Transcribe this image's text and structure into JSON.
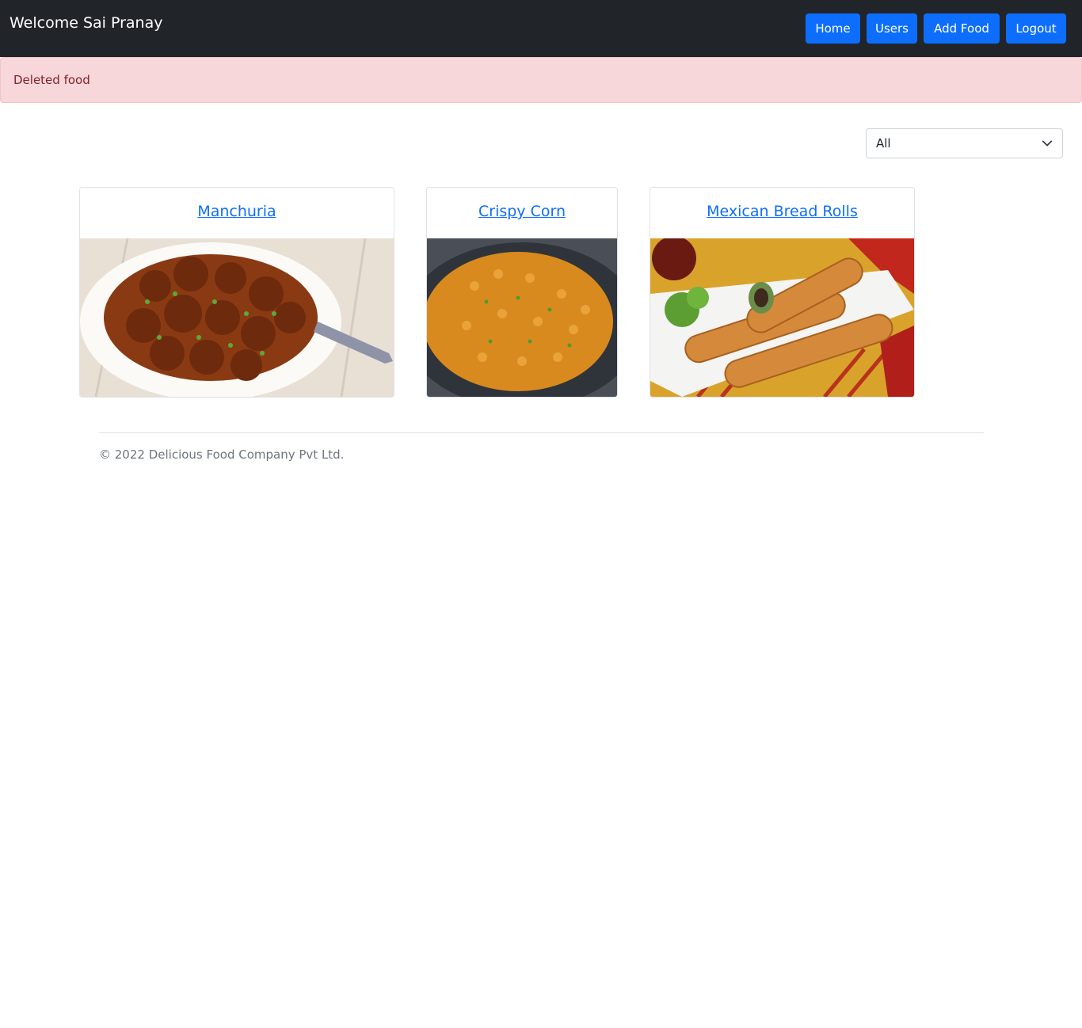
{
  "navbar": {
    "brand": "Welcome Sai Pranay",
    "buttons": {
      "home": "Home",
      "users": "Users",
      "add_food": "Add Food",
      "logout": "Logout"
    }
  },
  "alert": {
    "message": "Deleted food"
  },
  "filter": {
    "selected": "All"
  },
  "foods": [
    {
      "name": "Manchuria"
    },
    {
      "name": "Crispy Corn"
    },
    {
      "name": "Mexican Bread Rolls"
    }
  ],
  "footer": {
    "text": "© 2022 Delicious Food Company Pvt Ltd."
  },
  "colors": {
    "navbar_bg": "#212529",
    "primary": "#0d6efd",
    "alert_bg": "#f8d7da",
    "alert_text": "#842029",
    "muted_text": "#6c757d"
  }
}
